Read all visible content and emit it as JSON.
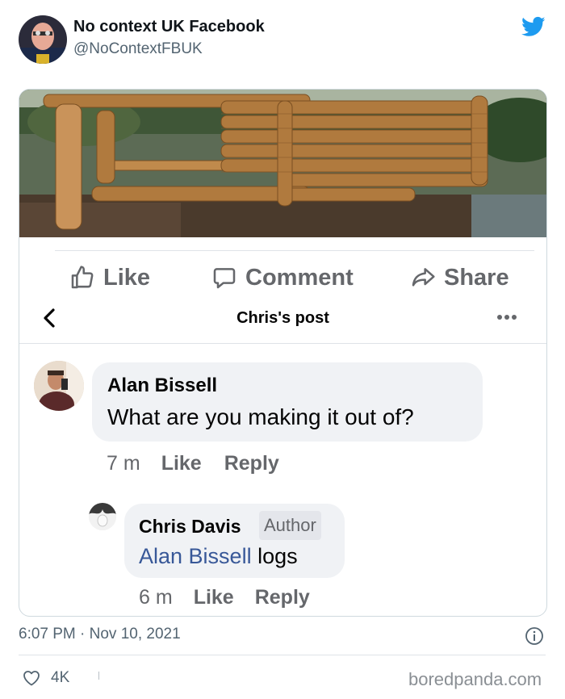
{
  "tweet": {
    "display_name": "No context UK Facebook",
    "handle": "@NoContextFBUK",
    "timestamp": "6:07 PM · Nov 10, 2021",
    "likes": "4K",
    "accent_color": "#1d9bf0"
  },
  "facebook": {
    "actions": {
      "like_label": "Like",
      "comment_label": "Comment",
      "share_label": "Share"
    },
    "post_title": "Chris's post",
    "comments": [
      {
        "author": "Alan Bissell",
        "text": "What are you making it out of?",
        "time": "7 m",
        "like_label": "Like",
        "reply_label": "Reply"
      },
      {
        "author": "Chris Davis",
        "badge": "Author",
        "mention": "Alan Bissell",
        "text": "logs",
        "time": "6 m",
        "like_label": "Like",
        "reply_label": "Reply"
      }
    ],
    "mention_color": "#385898"
  },
  "watermark": "boredpanda.com"
}
